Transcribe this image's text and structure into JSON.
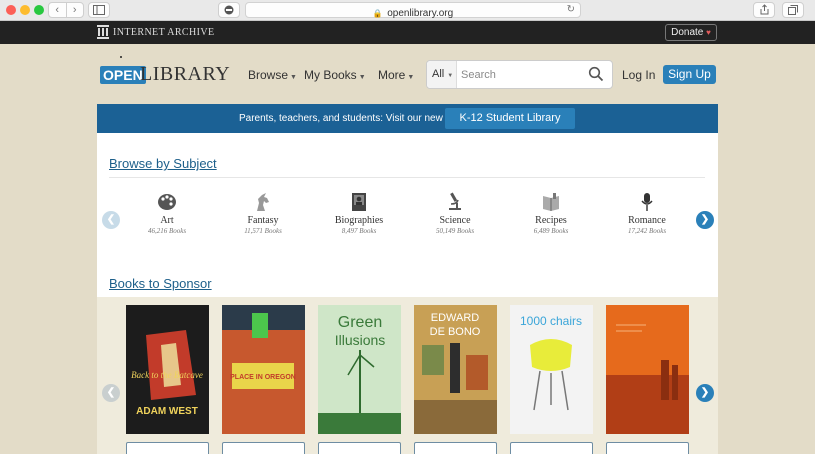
{
  "browser": {
    "url": "openlibrary.org",
    "nav_back": "‹",
    "nav_forward": "›",
    "sidebar_icon": "sidebar-icon",
    "privacy_icon": "privacy-report-icon",
    "reload_icon": "↻",
    "share_icon": "share-icon",
    "tabs_icon": "tabs-icon"
  },
  "ia_bar": {
    "brand": "INTERNET ARCHIVE",
    "donate_label": "Donate",
    "heart": "♥"
  },
  "header": {
    "logo_open": "OPEN",
    "logo_library": "LIBRARY",
    "menus": [
      {
        "label": "Browse"
      },
      {
        "label": "My Books"
      },
      {
        "label": "More"
      }
    ],
    "search_scope": "All",
    "search_placeholder": "Search",
    "login_label": "Log In",
    "signup_label": "Sign Up"
  },
  "banner": {
    "text": "Parents, teachers, and students: Visit our new",
    "button_label": "K-12 Student Library"
  },
  "browse_by_subject": {
    "title": "Browse by Subject",
    "subjects": [
      {
        "name": "Art",
        "count": "46,216 Books",
        "icon": "palette-icon"
      },
      {
        "name": "Fantasy",
        "count": "11,571 Books",
        "icon": "unicorn-icon"
      },
      {
        "name": "Biographies",
        "count": "8,497 Books",
        "icon": "portrait-book-icon"
      },
      {
        "name": "Science",
        "count": "50,149 Books",
        "icon": "microscope-icon"
      },
      {
        "name": "Recipes",
        "count": "6,489 Books",
        "icon": "recipe-book-icon"
      },
      {
        "name": "Romance",
        "count": "17,242 Books",
        "icon": "microphone-icon"
      }
    ]
  },
  "books_to_sponsor": {
    "title": "Books to Sponsor",
    "books": [
      {
        "cover_text_1": "Back to the Batcave",
        "cover_text_2": "ADAM WEST",
        "colors": [
          "#1c1c1c",
          "#c23b2a"
        ]
      },
      {
        "cover_text_1": "PLACE IN OREGON",
        "colors": [
          "#c7582e",
          "#e9d54a"
        ]
      },
      {
        "cover_text_1": "Green",
        "cover_text_2": "Illusions",
        "colors": [
          "#cfe6c8",
          "#3a7a3a"
        ]
      },
      {
        "cover_text_1": "EDWARD",
        "cover_text_2": "DE BONO",
        "colors": [
          "#c8a055",
          "#2d2d2d"
        ]
      },
      {
        "cover_text_1": "1000 chairs",
        "colors": [
          "#f3f3f3",
          "#e8ec3a"
        ]
      },
      {
        "colors": [
          "#e66a1c",
          "#b13e16"
        ]
      }
    ]
  }
}
